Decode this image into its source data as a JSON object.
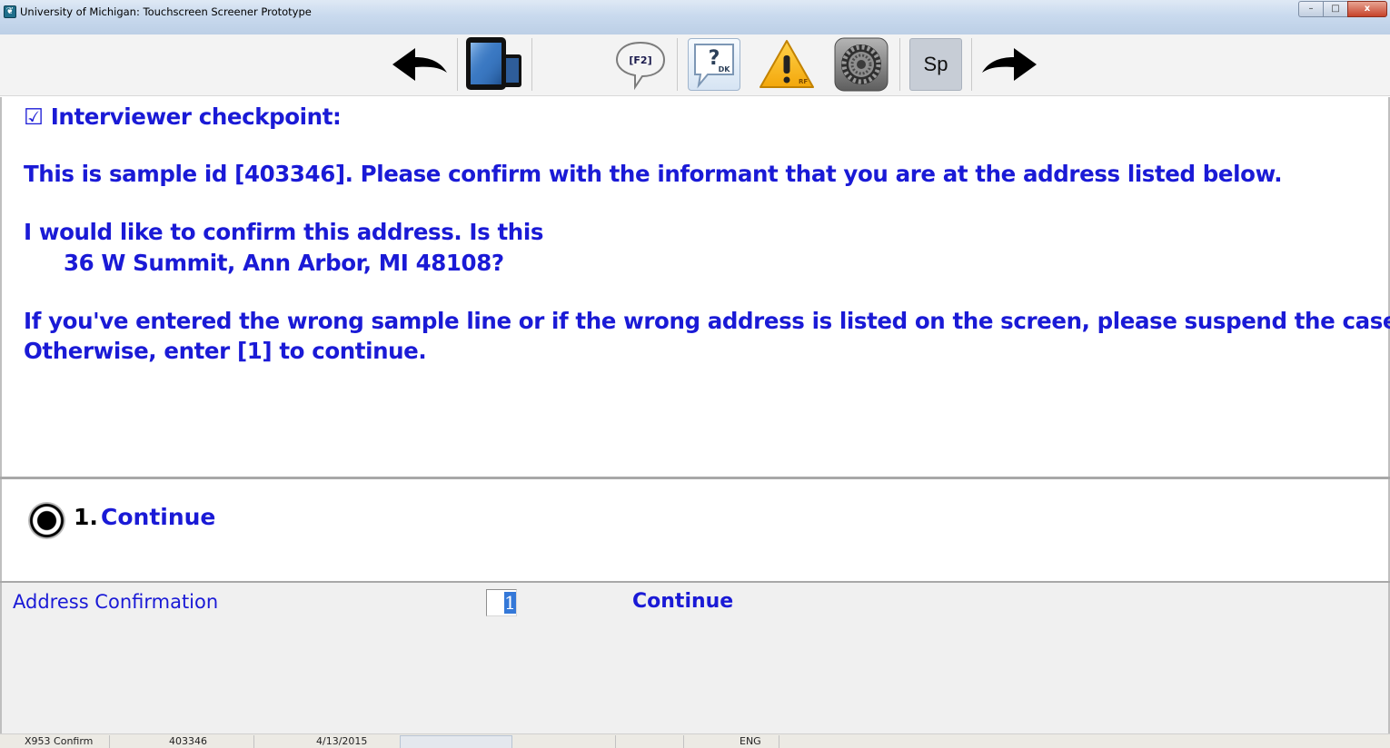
{
  "window": {
    "title": "University of Michigan: Touchscreen Screener Prototype",
    "minimize_glyph": "–",
    "maximize_glyph": "□",
    "close_glyph": "x"
  },
  "toolbar": {
    "f2_label": "[F2]",
    "dk_question": "?",
    "dk_label": "DK",
    "rf_label": "RF",
    "sp_label": "Sp"
  },
  "question": {
    "header": "☑ Interviewer checkpoint:",
    "line1": "This is sample id [403346]. Please confirm with the informant that you are at the address listed below.",
    "line2": "I would like to confirm this address. Is this",
    "address": "36 W Summit, Ann Arbor, MI  48108?",
    "line3": "If you've entered the wrong sample line or if the wrong address is listed on the screen, please suspend the case.",
    "line4": "Otherwise, enter [1] to continue."
  },
  "answers": [
    {
      "number": "1.",
      "label": "Continue",
      "selected": true
    }
  ],
  "datagrid": {
    "field_label": "Address Confirmation",
    "value": "1",
    "answer_text": "Continue"
  },
  "statusbar": {
    "field": "X953 Confirm",
    "sample_id": "403346",
    "date": "4/13/2015",
    "language": "ENG"
  }
}
